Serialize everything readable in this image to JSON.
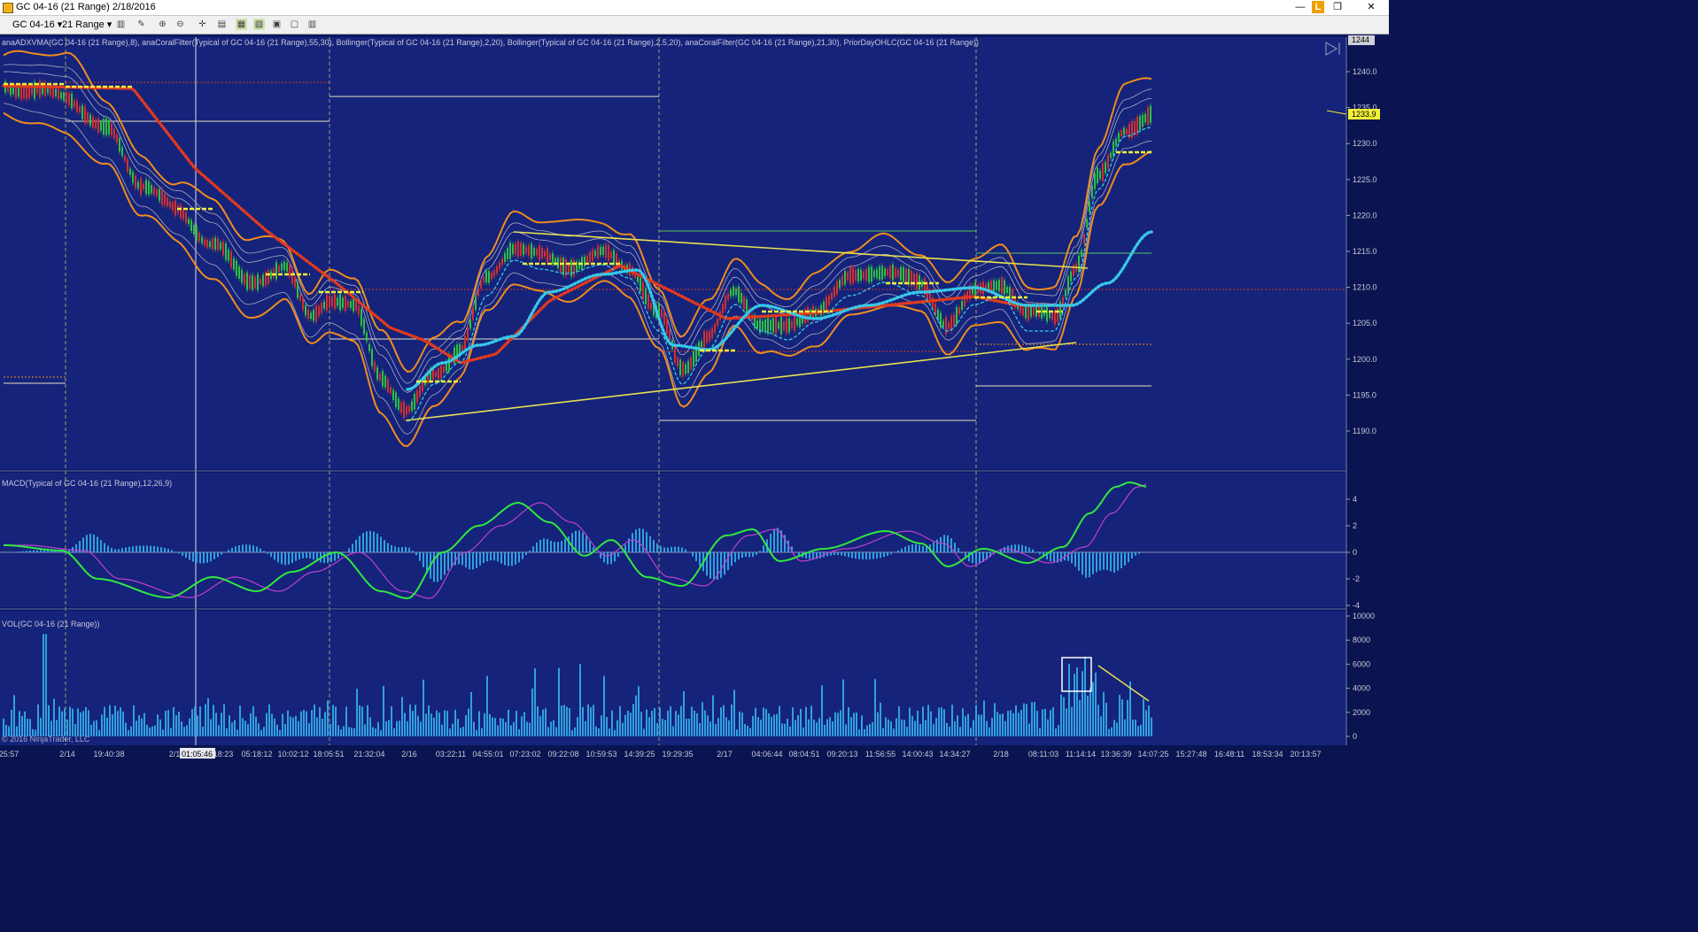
{
  "window": {
    "title": "GC 04-16 (21 Range)  2/18/2016",
    "btn_minimize": "—",
    "btn_alert": "L",
    "btn_restore": "❐",
    "btn_close": "✕"
  },
  "toolbar": {
    "instrument": "GC 04-16",
    "period": "21 Range",
    "icons": [
      "bar-type-icon",
      "draw-tool-icon",
      "zoom-in-icon",
      "zoom-out-icon",
      "crosshair-icon",
      "data-box-icon",
      "indicators-icon",
      "strategies-icon",
      "properties-icon",
      "window-icon"
    ]
  },
  "panels": {
    "price": {
      "label": "anaADXVMA(GC 04-16 (21 Range),8), anaCoralFilter(Typical of GC 04-16 (21 Range),55,30), Bollinger(Typical of GC 04-16 (21 Range),2,20), Bollinger(Typical of GC 04-16 (21 Range),2.5,20), anaCoralFilter(GC 04-16 (21 Range),21,30), PriorDayOHLC(GC 04-16 (21 Range))",
      "ticks": [
        "1240.0",
        "1235.0",
        "1230.0",
        "1225.0",
        "1220.0",
        "1215.0",
        "1210.0",
        "1205.0",
        "1200.0",
        "1195.0",
        "1190.0"
      ],
      "top_marker": "1244",
      "last_price": "1233.9"
    },
    "macd": {
      "label": "MACD(Typical of GC 04-16 (21 Range),12,26,9)",
      "ticks": [
        "4",
        "2",
        "0",
        "-2",
        "-4"
      ]
    },
    "volume": {
      "label": "VOL(GC 04-16 (21 Range))",
      "ticks": [
        "10000",
        "8000",
        "6000",
        "4000",
        "2000",
        "0"
      ]
    }
  },
  "xaxis": {
    "labels": [
      "25:57",
      "2/14",
      "19:40:38",
      "2/1",
      "01:05:46",
      "18:23",
      "05:18:12",
      "10:02:12",
      "18:05:51",
      "21:32:04",
      "2/16",
      "03:22:11",
      "04:55:01",
      "07:23:02",
      "09:22:08",
      "10:59:53",
      "14:39:25",
      "19:29:35",
      "2/17",
      "04:06:44",
      "08:04:51",
      "09:20:13",
      "11:56:55",
      "14:00:43",
      "14:34:27",
      "2/18",
      "08:11:03",
      "11:14:14",
      "13:36:39",
      "14:07:25",
      "15:27:48",
      "16:48:11",
      "18:53:34",
      "20:13:57"
    ],
    "crosshair_label": "01:05:46"
  },
  "copyright": "© 2016 NinjaTrader, LLC",
  "chart_data": {
    "type": "candlestick",
    "instrument": "GC 04-16 (21 Range)",
    "ylim": [
      1186,
      1246
    ],
    "last_price": 1233.9,
    "prior_day_levels": [
      1238.5,
      1209.0,
      1201.0,
      1202.0,
      1196.5,
      1197.5,
      1191.5
    ],
    "trendlines": [
      {
        "from": [
          1,
          1217.5
        ],
        "to": [
          2,
          1212.5
        ]
      },
      {
        "from": [
          1,
          1191.5
        ],
        "to": [
          2,
          1201.5
        ]
      }
    ],
    "macd": {
      "ylim": [
        -4.5,
        5.5
      ],
      "ticks": [
        4,
        2,
        0,
        -2,
        -4
      ]
    },
    "volume": {
      "ylim": [
        0,
        10000
      ],
      "ticks": [
        10000,
        8000,
        6000,
        4000,
        2000,
        0
      ]
    },
    "colors": {
      "background": "#15237a",
      "bollinger_outer": "#f08c1e",
      "coral_55": "#e03a1e",
      "coral_21": "#38c8e8",
      "adxvma": "#f2f03a",
      "trendline": "#e8e050",
      "macd_line": "#30e840",
      "macd_signal": "#c040d0",
      "volume_bar": "#30a0e0",
      "candle_up": "#30c040",
      "candle_down": "#d03030"
    }
  }
}
